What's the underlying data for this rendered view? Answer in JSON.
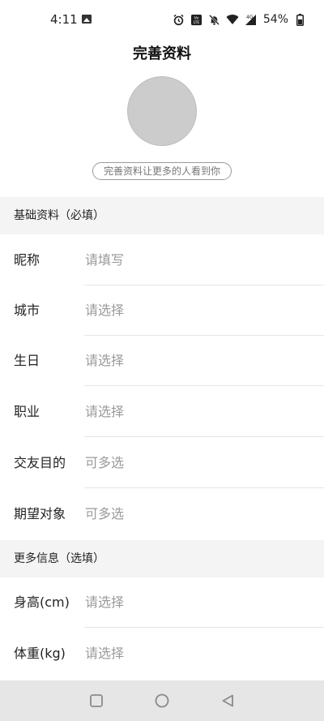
{
  "status_bar": {
    "time": "4:11",
    "battery": "54%",
    "network": "4G"
  },
  "header": {
    "title": "完善资料",
    "hint": "完善资料让更多的人看到你"
  },
  "sections": {
    "basic": {
      "title": "基础资料（必填）",
      "rows": [
        {
          "label": "昵称",
          "value": "请填写"
        },
        {
          "label": "城市",
          "value": "请选择"
        },
        {
          "label": "生日",
          "value": "请选择"
        },
        {
          "label": "职业",
          "value": "请选择"
        },
        {
          "label": "交友目的",
          "value": "可多选"
        },
        {
          "label": "期望对象",
          "value": "可多选"
        }
      ]
    },
    "more": {
      "title": "更多信息（选填）",
      "rows": [
        {
          "label": "身高(cm)",
          "value": "请选择"
        },
        {
          "label": "体重(kg)",
          "value": "请选择"
        }
      ]
    }
  },
  "nav_bar": {
    "icons": [
      "recents-square-icon",
      "home-circle-icon",
      "back-triangle-icon"
    ]
  },
  "colors": {
    "section_bg": "#f4f4f4",
    "placeholder": "#9a9a9a",
    "avatar": "#cccccc",
    "nav_bg": "#e6e6e6"
  }
}
